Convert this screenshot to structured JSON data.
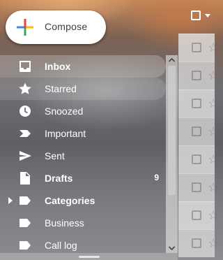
{
  "compose": {
    "label": "Compose"
  },
  "nav": {
    "items": [
      {
        "label": "Inbox",
        "icon": "inbox-icon",
        "bold": true,
        "count": ""
      },
      {
        "label": "Starred",
        "icon": "star-icon",
        "bold": false,
        "count": ""
      },
      {
        "label": "Snoozed",
        "icon": "clock-icon",
        "bold": false,
        "count": ""
      },
      {
        "label": "Important",
        "icon": "important-icon",
        "bold": false,
        "count": ""
      },
      {
        "label": "Sent",
        "icon": "send-icon",
        "bold": false,
        "count": ""
      },
      {
        "label": "Drafts",
        "icon": "draft-icon",
        "bold": true,
        "count": "9"
      },
      {
        "label": "Categories",
        "icon": "label-icon",
        "bold": true,
        "count": ""
      },
      {
        "label": "Business",
        "icon": "label-icon",
        "bold": false,
        "count": ""
      },
      {
        "label": "Call log",
        "icon": "label-icon",
        "bold": false,
        "count": ""
      }
    ]
  },
  "colors": {
    "compose_red": "#ea4335",
    "compose_blue": "#4285f4",
    "compose_yellow": "#fbbc04",
    "compose_green": "#34a853"
  }
}
